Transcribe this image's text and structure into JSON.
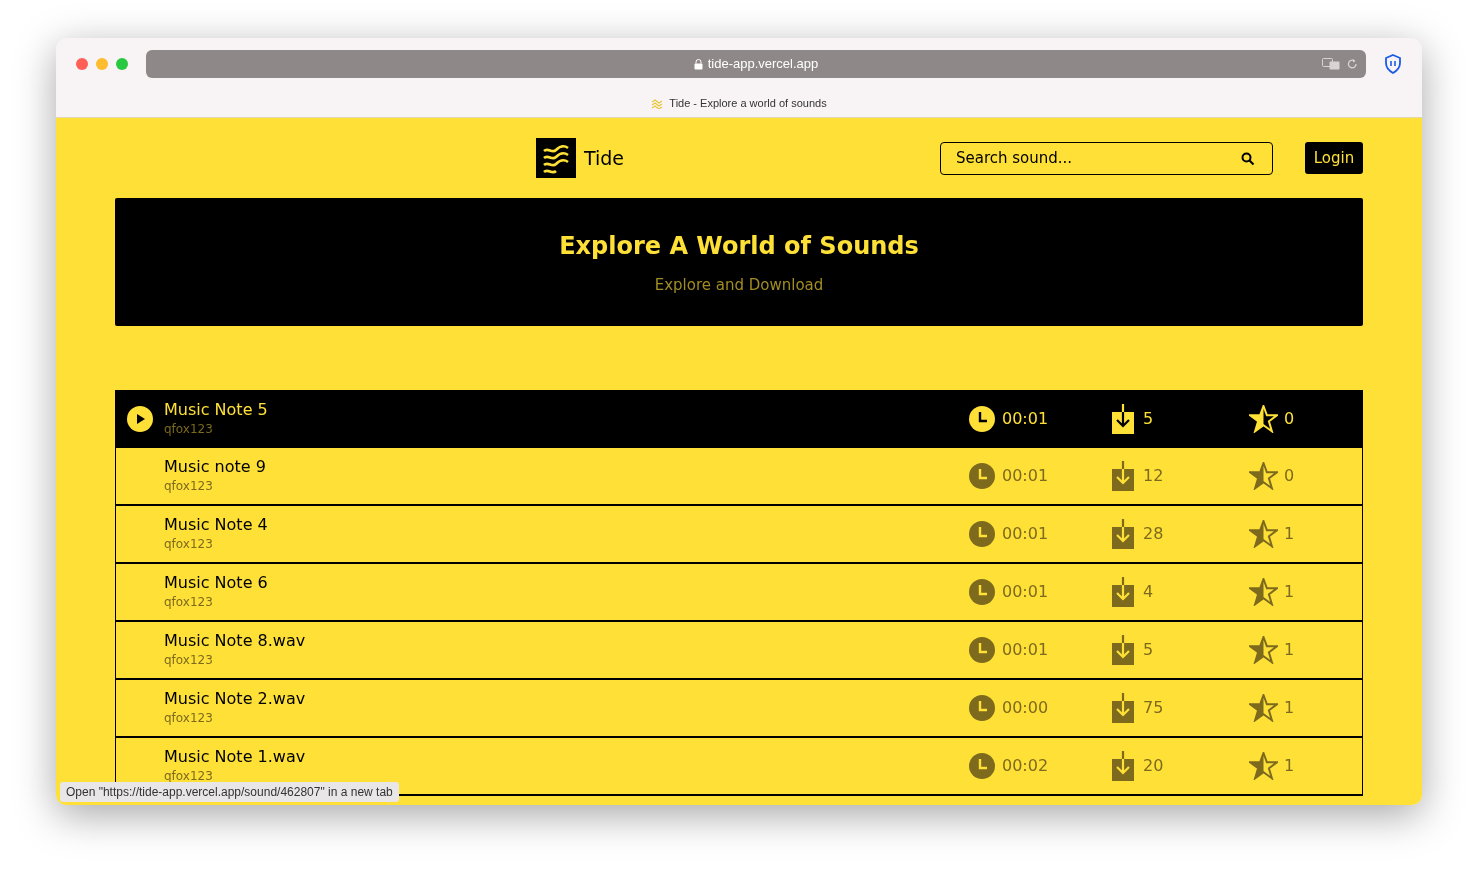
{
  "browser": {
    "address": "tide-app.vercel.app",
    "tab_title": "Tide - Explore a world of sounds"
  },
  "header": {
    "brand": "Tide",
    "search": {
      "placeholder": "Search sound..."
    },
    "login": "Login"
  },
  "banner": {
    "title": "Explore A World of Sounds",
    "subtitle": "Explore and Download"
  },
  "sounds": [
    {
      "title": "Music Note 5",
      "user": "qfox123",
      "duration": "00:01",
      "downloads": "5",
      "favorites": "0",
      "selected": true
    },
    {
      "title": "Music note 9",
      "user": "qfox123",
      "duration": "00:01",
      "downloads": "12",
      "favorites": "0",
      "selected": false
    },
    {
      "title": "Music Note 4",
      "user": "qfox123",
      "duration": "00:01",
      "downloads": "28",
      "favorites": "1",
      "selected": false
    },
    {
      "title": "Music Note 6",
      "user": "qfox123",
      "duration": "00:01",
      "downloads": "4",
      "favorites": "1",
      "selected": false
    },
    {
      "title": "Music Note 8.wav",
      "user": "qfox123",
      "duration": "00:01",
      "downloads": "5",
      "favorites": "1",
      "selected": false
    },
    {
      "title": "Music Note 2.wav",
      "user": "qfox123",
      "duration": "00:00",
      "downloads": "75",
      "favorites": "1",
      "selected": false
    },
    {
      "title": "Music Note 1.wav",
      "user": "qfox123",
      "duration": "00:02",
      "downloads": "20",
      "favorites": "1",
      "selected": false
    }
  ],
  "status_bar": "Open \"https://tide-app.vercel.app/sound/462807\" in a new tab"
}
